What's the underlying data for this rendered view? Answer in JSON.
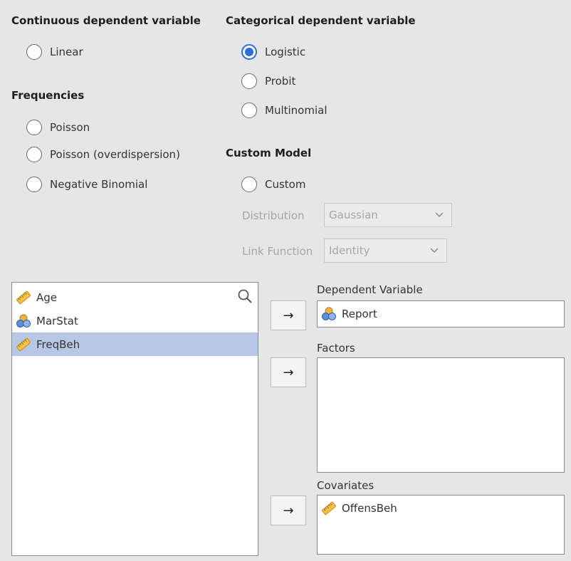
{
  "continuous": {
    "heading": "Continuous dependent variable",
    "linear_label": "Linear"
  },
  "frequencies": {
    "heading": "Frequencies",
    "poisson_label": "Poisson",
    "poisson_over_label": "Poisson (overdispersion)",
    "negbin_label": "Negative Binomial"
  },
  "categorical": {
    "heading": "Categorical dependent variable",
    "logistic_label": "Logistic",
    "probit_label": "Probit",
    "multinomial_label": "Multinomial"
  },
  "custom": {
    "heading": "Custom Model",
    "custom_label": "Custom",
    "distribution_label": "Distribution",
    "distribution_value": "Gaussian",
    "link_label": "Link Function",
    "link_value": "Identity"
  },
  "selected_model": "Logistic",
  "variables": [
    {
      "name": "Age",
      "type": "continuous-icon"
    },
    {
      "name": "MarStat",
      "type": "nominal-icon"
    },
    {
      "name": "FreqBeh",
      "type": "continuous-icon",
      "selected": true
    }
  ],
  "targets": {
    "dependent_label": "Dependent Variable",
    "dependent_value": "Report",
    "factors_label": "Factors",
    "covariates_label": "Covariates",
    "covariate_item": "OffensBeh"
  },
  "arrow_glyph": "→",
  "colors": {
    "accent": "#2d6fd8",
    "selected_row": "#b9c7e6",
    "panel_bg": "#e6e6e6"
  }
}
